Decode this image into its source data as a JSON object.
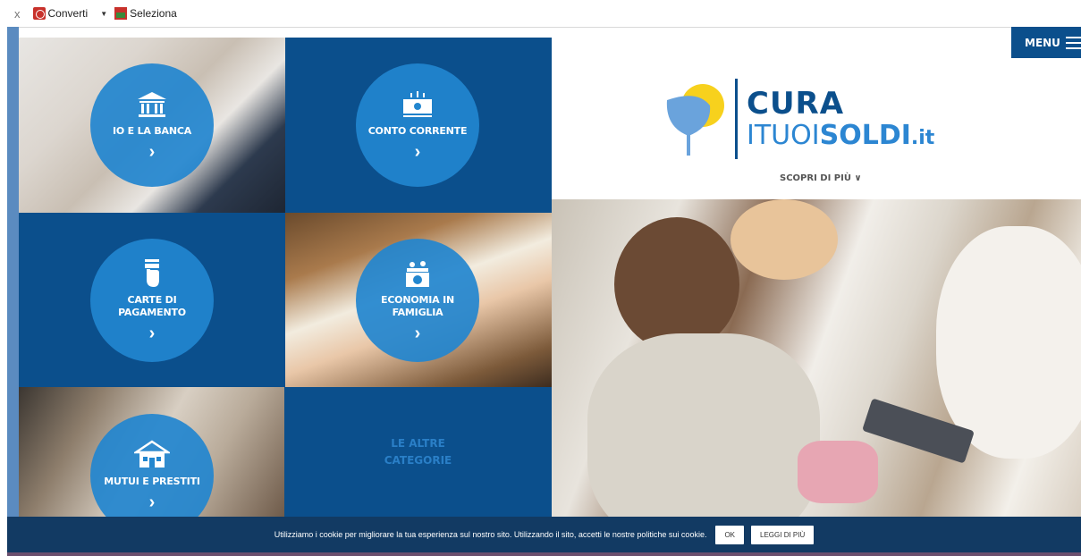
{
  "toolbar": {
    "close_glyph": "x",
    "convert_label": "Converti",
    "convert_caret": "▼",
    "select_label": "Seleziona"
  },
  "menu": {
    "label": "MENU"
  },
  "tiles": [
    {
      "label": "IO E LA BANCA",
      "icon": "bank-icon"
    },
    {
      "label": "CONTO CORRENTE",
      "icon": "banknote-icon"
    },
    {
      "label": "CARTE DI PAGAMENTO",
      "icon": "card-hand-icon"
    },
    {
      "label": "ECONOMIA IN FAMIGLIA",
      "icon": "family-savings-icon"
    },
    {
      "label": "MUTUI E PRESTITI",
      "icon": "house-icon"
    }
  ],
  "tile_chevron": "›",
  "other_categories": {
    "label": "LE ALTRE CATEGORIE"
  },
  "logo": {
    "line1": "CURA",
    "line2_part1": "ITUOI",
    "line2_part2": "SOLDI",
    "line2_part3": ".it",
    "brand_dark": "#0b4f8c",
    "brand_light": "#2c86d2",
    "accent_yellow": "#f7d11d"
  },
  "scopri": {
    "label": "SCOPRI DI PIÙ",
    "chevron": "∨"
  },
  "cookie": {
    "message": "Utilizziamo i cookie per migliorare la tua esperienza sul nostro sito. Utilizzando il sito, accetti le nostre politiche sui cookie.",
    "ok_label": "OK",
    "more_label": "LEGGI DI PIÙ"
  }
}
